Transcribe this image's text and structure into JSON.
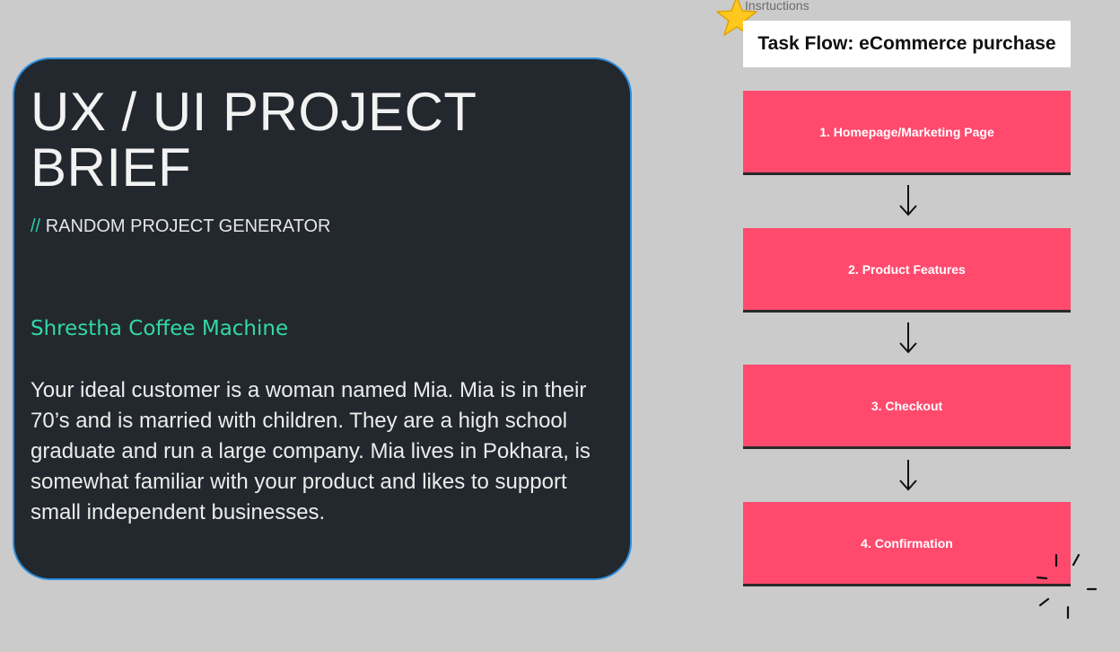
{
  "brief": {
    "title": "UX / UI PROJECT BRIEF",
    "subtitle_prefix": "//",
    "subtitle": "RANDOM PROJECT GENERATOR",
    "project_name": "Shrestha Coffee Machine",
    "description": "Your ideal customer is a woman named Mia. Mia is in their 70’s and is married with children. They are a high school graduate and run a large company. Mia lives in Pokhara, is somewhat familiar with your product and likes to support small independent businesses."
  },
  "flow": {
    "instructions_label": "Insrtuctions",
    "title": "Task Flow: eCommerce purchase",
    "steps": [
      {
        "label": "1. Homepage/Marketing Page"
      },
      {
        "label": "2. Product Features"
      },
      {
        "label": "3. Checkout"
      },
      {
        "label": "4. Confirmation"
      }
    ]
  },
  "colors": {
    "card_bg": "#22282e",
    "card_border": "#2f8fe0",
    "accent_green": "#32d8a8",
    "step_pink": "#ff4a6e",
    "star_yellow": "#ffc81e"
  },
  "icons": [
    "star-icon",
    "arrow-down-icon",
    "sparkle-icon"
  ]
}
